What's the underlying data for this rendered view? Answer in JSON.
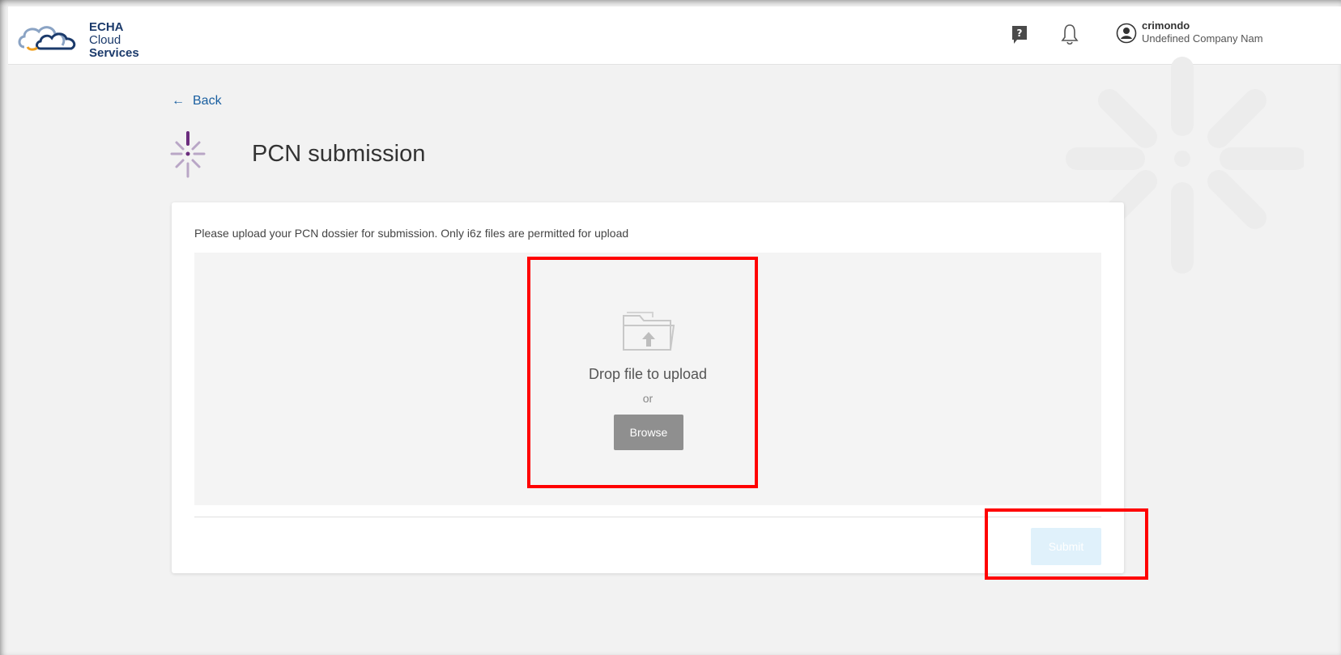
{
  "header": {
    "logo": {
      "line1": "ECHA",
      "line2_a": "Cloud ",
      "line2_b": "Services"
    },
    "help_icon": "help-icon",
    "bell_icon": "bell-icon",
    "user": {
      "name": "crimondo",
      "company": "Undefined Company Nam"
    }
  },
  "nav": {
    "back_label": "Back"
  },
  "page": {
    "title": "PCN submission"
  },
  "card": {
    "instruction": "Please upload your PCN dossier for submission. Only i6z files are permitted for upload",
    "dropzone": {
      "label": "Drop file to upload",
      "or": "or",
      "browse_label": "Browse"
    },
    "submit_label": "Submit",
    "submit_disabled": true
  },
  "colors": {
    "link": "#1a5fa0",
    "highlight": "#ff0000",
    "submit_disabled_bg": "#e0f1fb",
    "browse_bg": "#8f8f8f",
    "brand_purple": "#6a2c7d"
  }
}
